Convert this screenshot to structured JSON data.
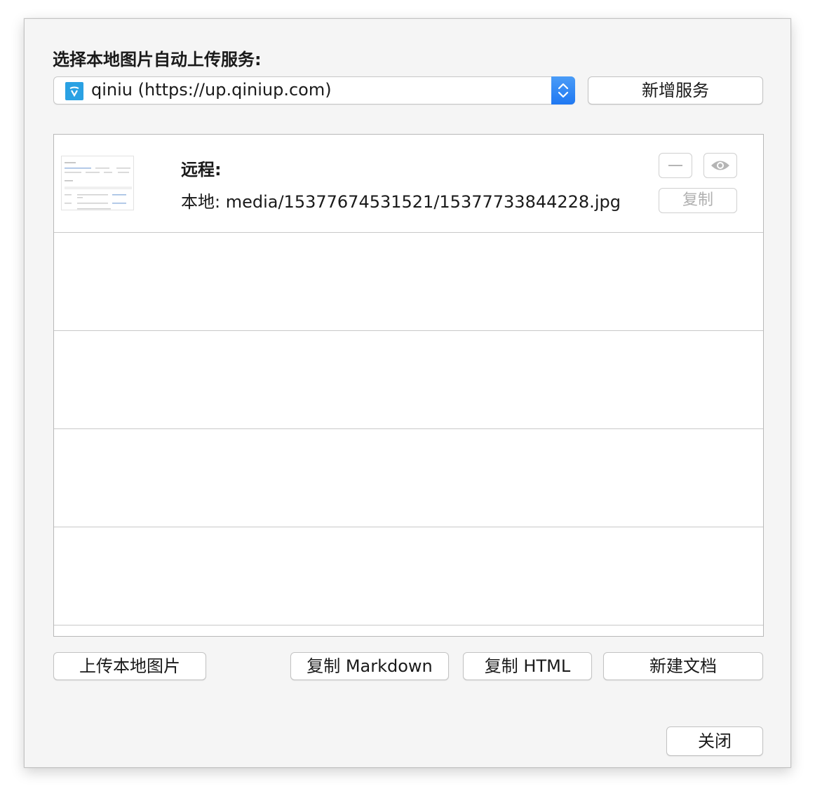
{
  "header": {
    "label": "选择本地图片自动上传服务:"
  },
  "service_select": {
    "value": "qiniu (https://up.qiniup.com)",
    "icon": "qiniu-logo-icon",
    "accent": "#2aa1e3"
  },
  "buttons": {
    "add_service": "新增服务",
    "upload_local": "上传本地图片",
    "copy_markdown": "复制 Markdown",
    "copy_html": "复制 HTML",
    "new_document": "新建文档",
    "close": "关闭"
  },
  "image_list": {
    "items": [
      {
        "remote_label": "远程:",
        "local_text": "本地:  media/15377674531521/15377733844228.jpg",
        "copy_label": "复制",
        "remove_icon": "minus-icon",
        "view_icon": "eye-icon"
      }
    ]
  }
}
